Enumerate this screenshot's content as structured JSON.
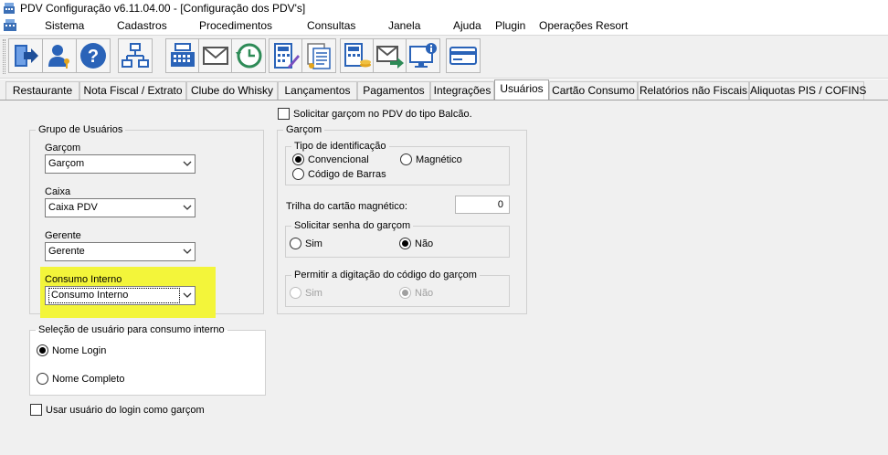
{
  "window": {
    "title": "PDV Configuração v6.11.04.00 - [Configuração dos PDV's]"
  },
  "menu": [
    "Sistema",
    "Cadastros",
    "Procedimentos",
    "Consultas",
    "Janela",
    "Ajuda",
    "Plugin",
    "Operações Resort"
  ],
  "toolbar": {
    "icons": [
      "exit-icon",
      "users-icon",
      "help-icon",
      "network-icon",
      "cash-register-icon",
      "mail-icon",
      "history-clock-icon",
      "calculator-pen-icon",
      "documents-icon",
      "calculator-coins-icon",
      "mail-forward-icon",
      "monitor-info-icon",
      "card-icon"
    ]
  },
  "tabs": [
    {
      "label": "Restaurante",
      "active": false
    },
    {
      "label": "Nota Fiscal / Extrato",
      "active": false
    },
    {
      "label": "Clube do Whisky",
      "active": false
    },
    {
      "label": "Lançamentos",
      "active": false
    },
    {
      "label": "Pagamentos",
      "active": false
    },
    {
      "label": "Integrações",
      "active": false
    },
    {
      "label": "Usuários",
      "active": true
    },
    {
      "label": "Cartão Consumo",
      "active": false
    },
    {
      "label": "Relatórios não Fiscais",
      "active": false
    },
    {
      "label": "Aliquotas PIS / COFINS",
      "active": false
    }
  ],
  "grupo_usuarios": {
    "legend": "Grupo de Usuários",
    "garcom": {
      "label": "Garçom",
      "value": "Garçom"
    },
    "caixa": {
      "label": "Caixa",
      "value": "Caixa PDV"
    },
    "gerente": {
      "label": "Gerente",
      "value": "Gerente"
    },
    "consumo": {
      "label": "Consumo Interno",
      "value": "Consumo Interno"
    }
  },
  "solicitar_garcom_balcao": {
    "label": "Solicitar garçom no PDV do tipo Balcão.",
    "checked": false
  },
  "garcom_group": {
    "legend": "Garçom",
    "tipo_identificacao": {
      "legend": "Tipo de identificação",
      "convencional": {
        "label": "Convencional",
        "selected": true
      },
      "magnetico": {
        "label": "Magnético",
        "selected": false
      },
      "codigo_barras": {
        "label": "Código de Barras",
        "selected": false
      }
    },
    "trilha": {
      "label": "Trilha do cartão magnético:",
      "value": "0"
    },
    "solicitar_senha": {
      "legend": "Solicitar senha do garçom",
      "sim": {
        "label": "Sim",
        "selected": false
      },
      "nao": {
        "label": "Não",
        "selected": true
      }
    },
    "permitir_digitacao": {
      "legend": "Permitir a digitação do código do garçom",
      "sim": {
        "label": "Sim",
        "selected": false
      },
      "nao": {
        "label": "Não",
        "selected": true
      },
      "disabled": true
    }
  },
  "selecao_usuario": {
    "legend": "Seleção de usuário para consumo interno",
    "nome_login": {
      "label": "Nome Login",
      "selected": true
    },
    "nome_completo": {
      "label": "Nome Completo",
      "selected": false
    }
  },
  "usar_usuario_login": {
    "label": "Usar usuário do login como garçom",
    "checked": false
  },
  "colors": {
    "highlight": "#f3f53a",
    "tab_active_bg": "#ffffff",
    "panel_bg": "#f0f0f0"
  }
}
